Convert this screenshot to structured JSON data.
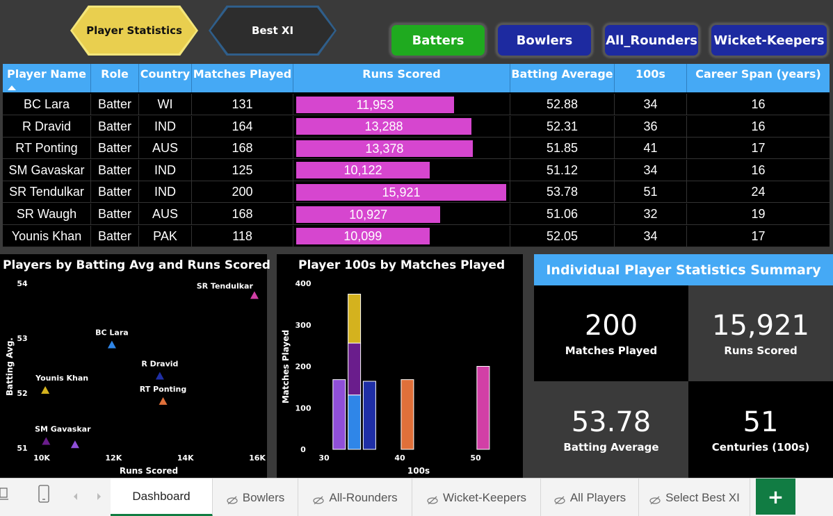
{
  "nav": {
    "player_statistics": "Player Statistics",
    "best_xi": "Best XI",
    "batters": "Batters",
    "bowlers": "Bowlers",
    "all_rounders": "All_Rounders",
    "wicket_keepers": "Wicket-Keepers"
  },
  "table": {
    "headers": [
      "Player Name",
      "Role",
      "Country",
      "Matches Played",
      "Runs Scored",
      "Batting Average",
      "100s",
      "Career Span (years)"
    ],
    "runs_max": 15921,
    "rows": [
      {
        "name": "BC Lara",
        "role": "Batter",
        "country": "WI",
        "matches": "131",
        "runs": "11,953",
        "runs_value": 11953,
        "avg": "52.88",
        "hundreds": "34",
        "span": "16"
      },
      {
        "name": "R Dravid",
        "role": "Batter",
        "country": "IND",
        "matches": "164",
        "runs": "13,288",
        "runs_value": 13288,
        "avg": "52.31",
        "hundreds": "36",
        "span": "16"
      },
      {
        "name": "RT Ponting",
        "role": "Batter",
        "country": "AUS",
        "matches": "168",
        "runs": "13,378",
        "runs_value": 13378,
        "avg": "51.85",
        "hundreds": "41",
        "span": "17"
      },
      {
        "name": "SM Gavaskar",
        "role": "Batter",
        "country": "IND",
        "matches": "125",
        "runs": "10,122",
        "runs_value": 10122,
        "avg": "51.12",
        "hundreds": "34",
        "span": "16"
      },
      {
        "name": "SR Tendulkar",
        "role": "Batter",
        "country": "IND",
        "matches": "200",
        "runs": "15,921",
        "runs_value": 15921,
        "avg": "53.78",
        "hundreds": "51",
        "span": "24"
      },
      {
        "name": "SR Waugh",
        "role": "Batter",
        "country": "AUS",
        "matches": "168",
        "runs": "10,927",
        "runs_value": 10927,
        "avg": "51.06",
        "hundreds": "32",
        "span": "19"
      },
      {
        "name": "Younis Khan",
        "role": "Batter",
        "country": "PAK",
        "matches": "118",
        "runs": "10,099",
        "runs_value": 10099,
        "avg": "52.05",
        "hundreds": "34",
        "span": "17"
      }
    ]
  },
  "chart_data": [
    {
      "type": "scatter",
      "title": "Players by Batting Avg and Runs Scored",
      "xlabel": "Runs Scored",
      "ylabel": "Batting Avg.",
      "xlim": [
        10000,
        16000
      ],
      "ylim": [
        51,
        54
      ],
      "x_ticks": [
        "10K",
        "12K",
        "14K",
        "16K"
      ],
      "y_ticks": [
        "51",
        "52",
        "53",
        "54"
      ],
      "points": [
        {
          "label": "BC Lara",
          "x": 11953,
          "y": 52.88,
          "color": "#2f86e8"
        },
        {
          "label": "R Dravid",
          "x": 13288,
          "y": 52.31,
          "color": "#1f2fa6"
        },
        {
          "label": "RT Ponting",
          "x": 13378,
          "y": 51.85,
          "color": "#e0703a"
        },
        {
          "label": "SM Gavaskar",
          "x": 10122,
          "y": 51.12,
          "color": "#6a1d8c"
        },
        {
          "label": "SR Tendulkar",
          "x": 15921,
          "y": 53.78,
          "color": "#d23fa6"
        },
        {
          "label": "",
          "x": 10927,
          "y": 51.06,
          "color": "#8f4fd8"
        },
        {
          "label": "Younis Khan",
          "x": 10099,
          "y": 52.05,
          "color": "#d4b21e"
        }
      ]
    },
    {
      "type": "bar",
      "title": "Player 100s by Matches Played",
      "xlabel": "100s",
      "ylabel": "Matches Played",
      "xlim": [
        30,
        52
      ],
      "ylim": [
        0,
        400
      ],
      "x_ticks": [
        "30",
        "40",
        "50"
      ],
      "y_ticks": [
        "0",
        "100",
        "200",
        "300",
        "400"
      ],
      "stacks": [
        {
          "x": 32,
          "segments": [
            {
              "value": 168,
              "color": "#8f4fd8"
            }
          ]
        },
        {
          "x": 34,
          "segments": [
            {
              "value": 131,
              "color": "#2f86e8"
            },
            {
              "value": 125,
              "color": "#6a1d8c"
            },
            {
              "value": 118,
              "color": "#d4b21e"
            }
          ]
        },
        {
          "x": 36,
          "segments": [
            {
              "value": 164,
              "color": "#1f2fa6"
            }
          ]
        },
        {
          "x": 41,
          "segments": [
            {
              "value": 168,
              "color": "#e0703a"
            }
          ]
        },
        {
          "x": 51,
          "segments": [
            {
              "value": 200,
              "color": "#d23fa6"
            }
          ]
        }
      ]
    }
  ],
  "summary": {
    "title": "Individual Player Statistics Summary",
    "matches_value": "200",
    "matches_label": "Matches Played",
    "runs_value": "15,921",
    "runs_label": "Runs Scored",
    "avg_value": "53.78",
    "avg_label": "Batting Average",
    "centuries_value": "51",
    "centuries_label": "Centuries (100s)"
  },
  "sheets": {
    "dashboard": "Dashboard",
    "bowlers": "Bowlers",
    "all_rounders": "All-Rounders",
    "wicket_keepers": "Wicket-Keepers",
    "all_players": "All Players",
    "select_best_xi": "Select Best XI",
    "add": "+"
  }
}
